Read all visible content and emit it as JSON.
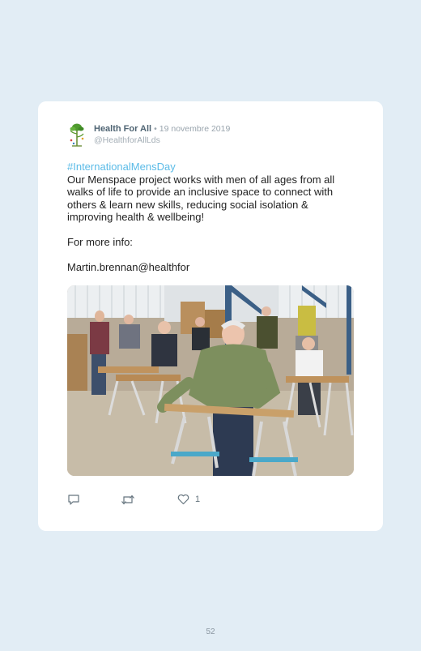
{
  "tweet": {
    "author_name": "Health For All",
    "date": "• 19 novembre 2019",
    "handle": "@HealthforAllLds",
    "hashtag": "#InternationalMensDay",
    "body": "Our Menspace project works with men of all ages from all walks of life to provide an inclusive space to connect with others & learn new skills, reducing social isolation & improving health & wellbeing!",
    "more_info_label": "For more info:",
    "email": "Martin.brennan@healthfor"
  },
  "actions": {
    "reply_icon": "reply-icon",
    "retweet_icon": "retweet-icon",
    "like_icon": "heart-icon",
    "like_count": "1"
  },
  "page": {
    "number": "52"
  },
  "colors": {
    "background": "#e2edf5",
    "card": "#ffffff",
    "hashtag": "#5bbbe7"
  }
}
